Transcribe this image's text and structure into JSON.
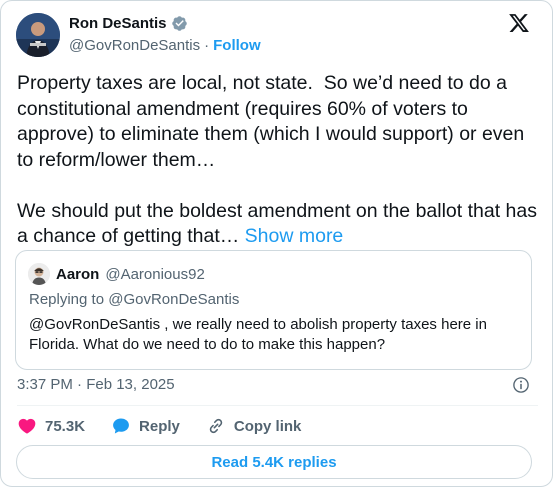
{
  "author": {
    "display_name": "Ron DeSantis",
    "handle": "@GovRonDeSantis",
    "separator": "·",
    "follow_label": "Follow"
  },
  "tweet": {
    "text": "Property taxes are local, not state.  So we’d need to do a constitutional amendment (requires 60% of voters to approve) to eliminate them (which I would support) or even to reform/lower them…\n\nWe should put the boldest amendment on the ballot that has a chance of getting that… ",
    "show_more_label": "Show more"
  },
  "quoted": {
    "display_name": "Aaron",
    "handle": "@Aaronious92",
    "replying_to": "Replying to @GovRonDeSantis",
    "text": "@GovRonDeSantis , we really need to abolish property taxes here in Florida. What do we need to do to make this happen?"
  },
  "timestamp": "3:37 PM · Feb 13, 2025",
  "actions": {
    "likes": "75.3K",
    "reply_label": "Reply",
    "copy_link_label": "Copy link"
  },
  "read_replies_label": "Read 5.4K replies",
  "colors": {
    "accent": "#1d9bf0",
    "like": "#f91880",
    "text": "#0f1419",
    "muted": "#536471",
    "border": "#cfd9de"
  },
  "icons": [
    "verified-badge-icon",
    "x-logo-icon",
    "info-icon",
    "heart-icon",
    "reply-bubble-icon",
    "link-icon"
  ]
}
